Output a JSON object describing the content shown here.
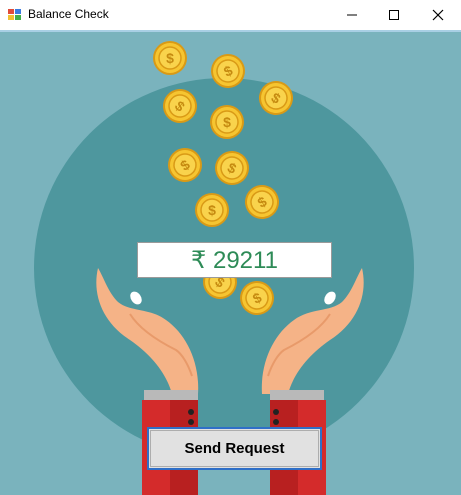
{
  "window": {
    "title": "Balance Check",
    "controls": {
      "minimize": "—",
      "maximize": "☐",
      "close": "✕"
    }
  },
  "balance": {
    "currency_symbol": "₹",
    "amount": "29211",
    "display": "₹ 29211"
  },
  "actions": {
    "send_request_label": "Send Request"
  },
  "colors": {
    "background": "#7ab3bd",
    "circle": "#4e979e",
    "coin": "#f2c230",
    "amount_text": "#2e8b57",
    "button_border": "#2f6fc8",
    "sleeve": "#d42b2b"
  },
  "illustration": {
    "icons": [
      "dollar-coin-icon",
      "hands-icon"
    ]
  }
}
